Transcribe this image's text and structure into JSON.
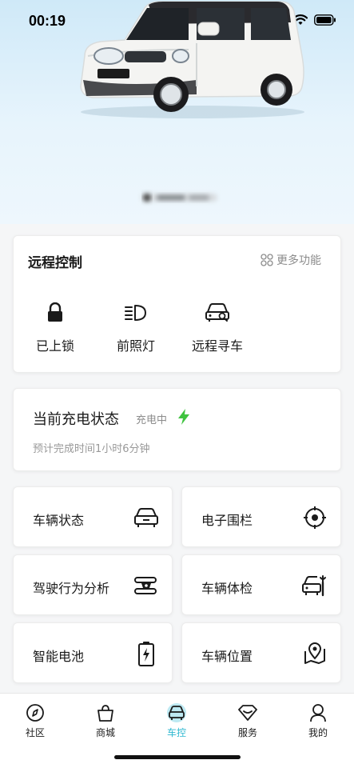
{
  "status_bar": {
    "time": "00:19"
  },
  "remote_control": {
    "title": "远程控制",
    "more_label": "更多功能",
    "actions": [
      {
        "label": "已上锁",
        "icon": "lock-icon"
      },
      {
        "label": "前照灯",
        "icon": "headlight-icon"
      },
      {
        "label": "远程寻车",
        "icon": "find-car-icon"
      }
    ]
  },
  "charging": {
    "title": "当前充电状态",
    "status": "充电中",
    "estimate": "预计完成时间1小时6分钟",
    "accent_color": "#3fc33f"
  },
  "tiles": [
    {
      "label": "车辆状态",
      "icon": "car-status-icon"
    },
    {
      "label": "电子围栏",
      "icon": "geofence-icon"
    },
    {
      "label": "驾驶行为分析",
      "icon": "driving-behavior-icon"
    },
    {
      "label": "车辆体检",
      "icon": "vehicle-check-icon"
    },
    {
      "label": "智能电池",
      "icon": "battery-icon"
    },
    {
      "label": "车辆位置",
      "icon": "location-icon"
    }
  ],
  "tabbar": {
    "active_color": "#2db7d0",
    "tabs": [
      {
        "label": "社区",
        "icon": "compass-icon"
      },
      {
        "label": "商城",
        "icon": "shopping-bag-icon"
      },
      {
        "label": "车控",
        "icon": "car-control-icon",
        "active": true
      },
      {
        "label": "服务",
        "icon": "service-icon"
      },
      {
        "label": "我的",
        "icon": "user-icon"
      }
    ]
  }
}
